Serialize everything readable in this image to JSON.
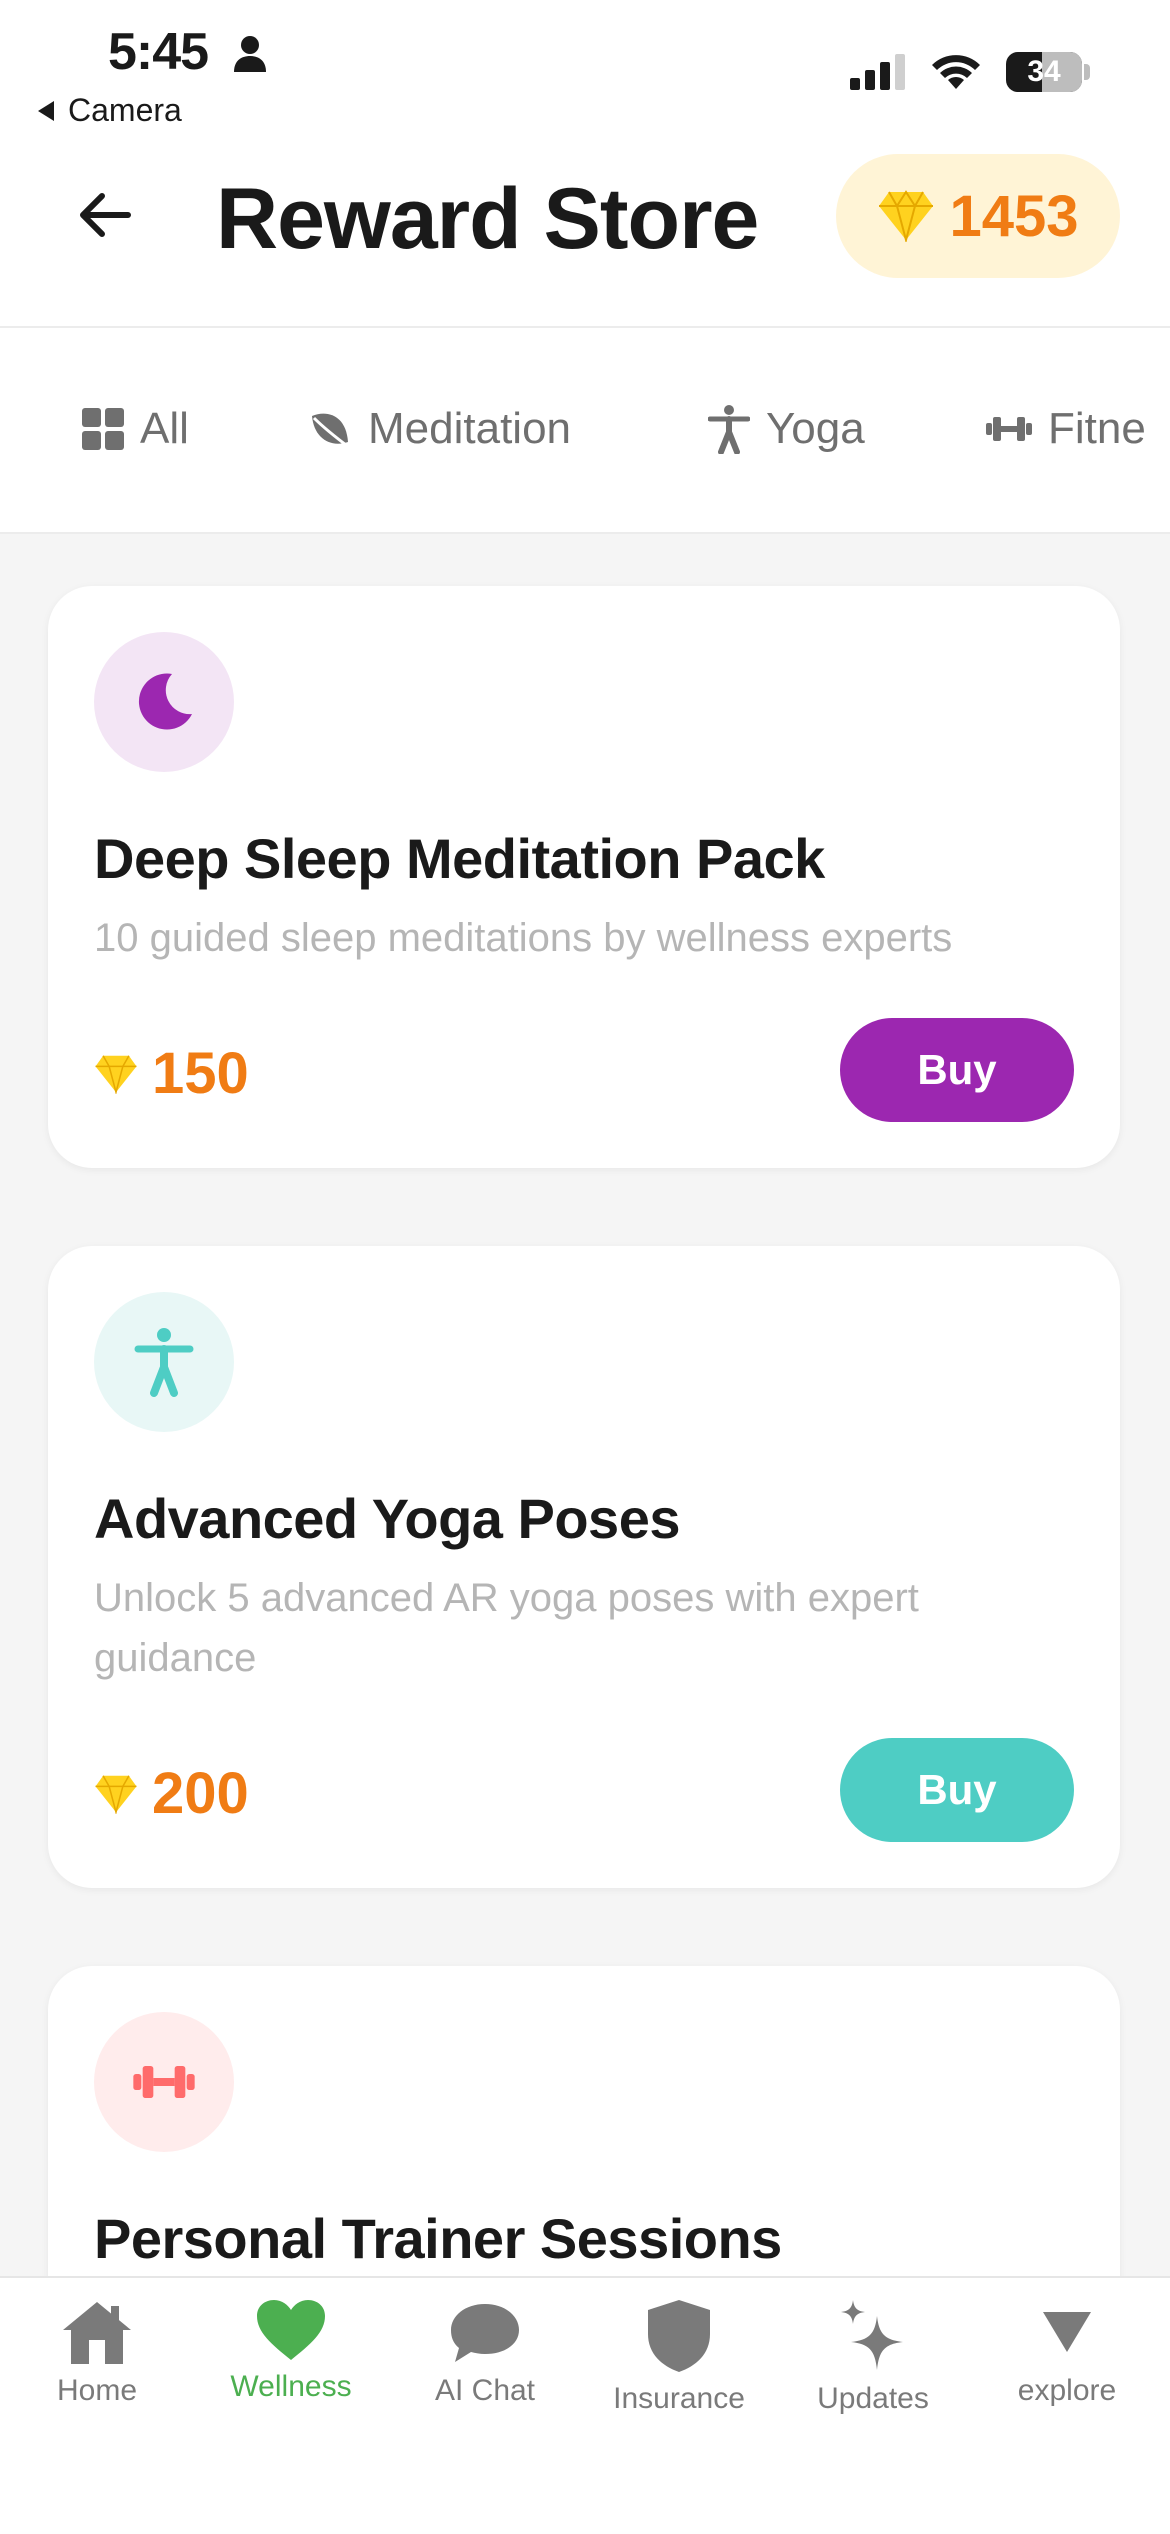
{
  "status_bar": {
    "time": "5:45",
    "back_app": "Camera",
    "battery": "34"
  },
  "header": {
    "title": "Reward Store",
    "points": "1453"
  },
  "tabs": [
    {
      "label": "All",
      "icon": "grid-icon"
    },
    {
      "label": "Meditation",
      "icon": "leaf-icon"
    },
    {
      "label": "Yoga",
      "icon": "person-icon"
    },
    {
      "label": "Fitne",
      "icon": "dumbbell-icon"
    }
  ],
  "products": [
    {
      "title": "Deep Sleep Meditation Pack",
      "description": "10 guided sleep meditations by wellness experts",
      "price": "150",
      "buy_label": "Buy",
      "icon": "moon-icon",
      "accent": "#9c27b0",
      "icon_bg": "#f3e5f5"
    },
    {
      "title": "Advanced Yoga Poses",
      "description": "Unlock 5 advanced AR yoga poses with expert guidance",
      "price": "200",
      "buy_label": "Buy",
      "icon": "yoga-person-icon",
      "accent": "#4ecdc4",
      "icon_bg": "#e8f7f6"
    },
    {
      "title": "Personal Trainer Sessions",
      "icon": "dumbbell-icon",
      "accent": "#ff6b6b",
      "icon_bg": "#ffecec"
    }
  ],
  "bottom_nav": [
    {
      "label": "Home",
      "icon": "home-icon"
    },
    {
      "label": "Wellness",
      "icon": "heart-icon",
      "active": true
    },
    {
      "label": "AI Chat",
      "icon": "chat-bubble-icon"
    },
    {
      "label": "Insurance",
      "icon": "shield-icon"
    },
    {
      "label": "Updates",
      "icon": "sparkles-icon"
    },
    {
      "label": "explore",
      "icon": "triangle-down-icon"
    }
  ],
  "colors": {
    "points_orange": "#f07c14",
    "points_badge_bg": "#fff4d6",
    "gem_yellow": "#ffd21f",
    "nav_active": "#4caf50"
  }
}
